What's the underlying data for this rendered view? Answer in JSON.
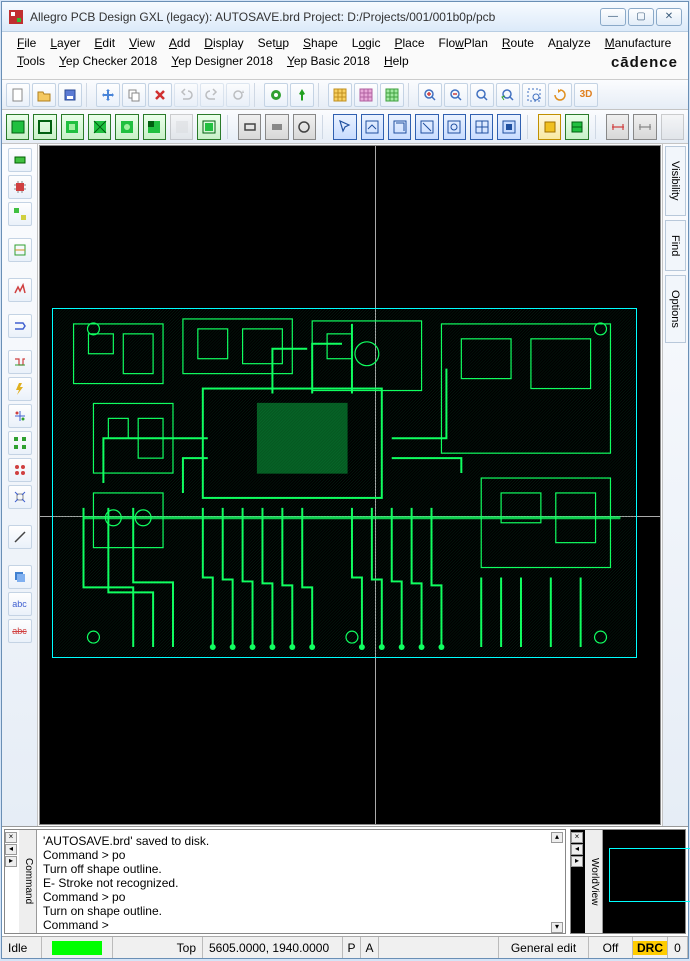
{
  "title": "Allegro PCB Design GXL (legacy): AUTOSAVE.brd  Project: D:/Projects/001/001b0p/pcb",
  "brand": "cādence",
  "menu": [
    "File",
    "Layer",
    "Edit",
    "View",
    "Add",
    "Display",
    "Setup",
    "Shape",
    "Logic",
    "Place",
    "FlowPlan",
    "Route",
    "Analyze",
    "Manufacture",
    "Tools",
    "Yep Checker 2018",
    "Yep Designer 2018",
    "Yep Basic 2018",
    "Help"
  ],
  "right_tabs": [
    "Visibility",
    "Find",
    "Options"
  ],
  "command_log": [
    "'AUTOSAVE.brd' saved to disk.",
    "Command > po",
    "Turn off shape outline.",
    "E- Stroke not recognized.",
    "Command > po",
    "Turn on shape outline.",
    "Command >"
  ],
  "command_tab": "Command",
  "worldview_tab": "WorldView",
  "status": {
    "idle": "Idle",
    "layer": "Top",
    "coords": "5605.0000, 1940.0000",
    "p": "P",
    "a": "A",
    "mode": "General edit",
    "off": "Off",
    "drc": "DRC",
    "zero": "0"
  }
}
